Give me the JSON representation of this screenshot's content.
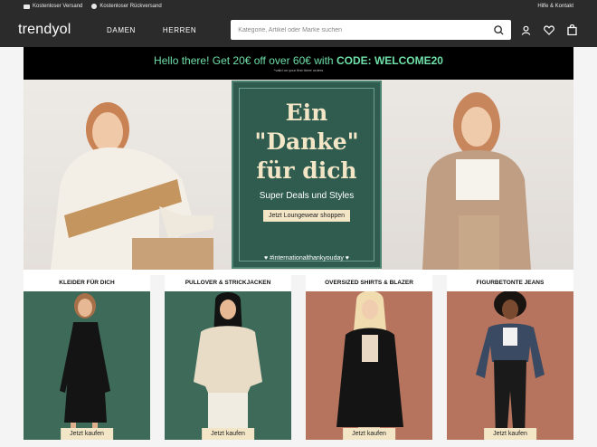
{
  "topbar": {
    "shipping": "Kostenloser Versand",
    "returns": "Kostenloser Rückversand",
    "help": "Hilfe & Kontakt"
  },
  "header": {
    "logo": "trendyol",
    "nav": [
      "DAMEN",
      "HERREN"
    ],
    "search_placeholder": "Kategorie, Artikel oder Marke suchen",
    "icons": [
      "user-icon",
      "heart-icon",
      "bag-icon"
    ]
  },
  "promo": {
    "text": "Hello there! Get 20€ off over 60€ with ",
    "code": "CODE: WELCOME20",
    "note": "*valid on your first three orders"
  },
  "hero": {
    "title_line1": "Ein",
    "title_line2": "\"Danke\"",
    "title_line3": "für dich",
    "subtitle": "Super Deals und Styles",
    "button": "Jetzt Loungewear shoppen",
    "hashtag": "♥ #internationalthankyouday ♥"
  },
  "categories": [
    {
      "title": "KLEIDER FÜR DICH",
      "button": "Jetzt kaufen",
      "bg": "#3d6a59"
    },
    {
      "title": "PULLOVER & STRICKJACKEN",
      "button": "Jetzt kaufen",
      "bg": "#3d6a59"
    },
    {
      "title": "OVERSIZED SHIRTS & BLAZER",
      "button": "Jetzt kaufen",
      "bg": "#b6745e"
    },
    {
      "title": "FIGURBETONTE JEANS",
      "button": "Jetzt kaufen",
      "bg": "#b6745e"
    }
  ],
  "colors": {
    "header_bg": "#2b2b2b",
    "promo_text": "#6ee0a8",
    "hero_green": "#2f5c4e",
    "hero_cream": "#f3e6c7"
  }
}
